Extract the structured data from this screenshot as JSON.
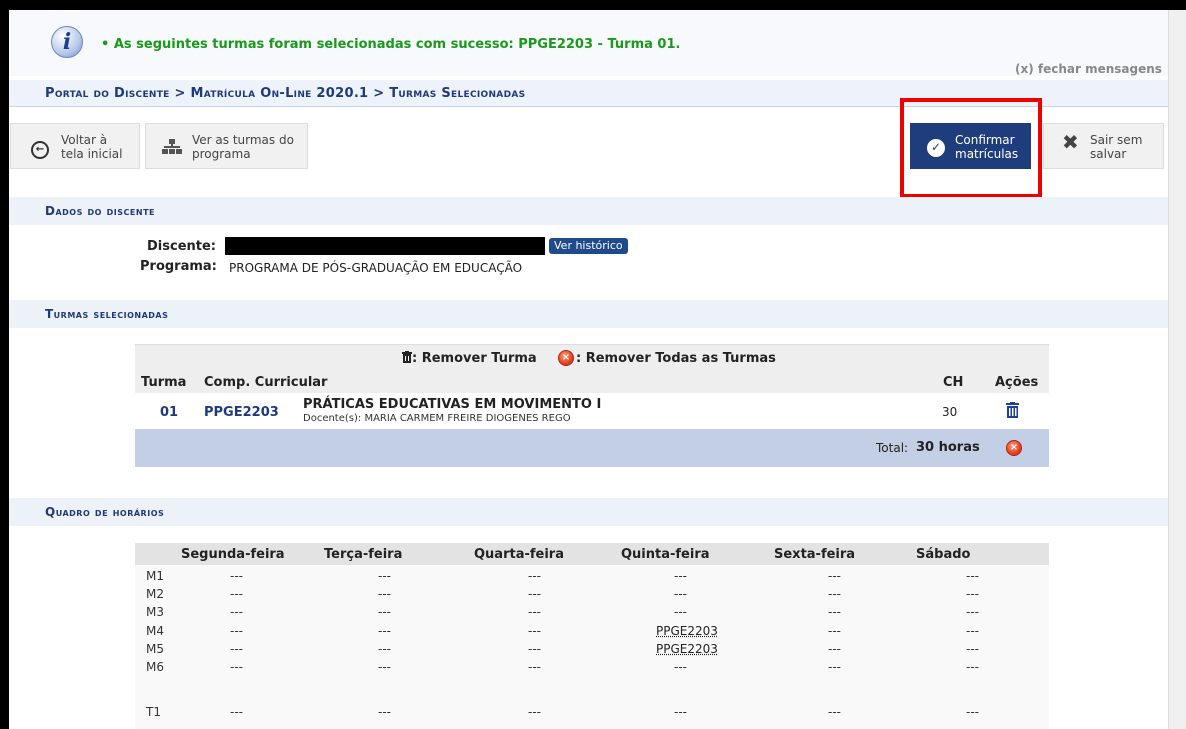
{
  "message": {
    "text": "• As seguintes turmas foram selecionadas com sucesso: PPGE2203 - Turma 01.",
    "close": "(x) fechar mensagens",
    "icon": "info-icon"
  },
  "breadcrumb": "Portal do Discente > Matrícula On-Line 2020.1 > Turmas Selecionadas",
  "toolbar": {
    "voltar": [
      "Voltar à",
      "tela inicial"
    ],
    "ver": [
      "Ver as turmas do",
      "programa"
    ],
    "confirmar": [
      "Confirmar",
      "matrículas"
    ],
    "sair": [
      "Sair sem",
      "salvar"
    ]
  },
  "dados": {
    "title": "Dados do discente",
    "discente_label": "Discente:",
    "ver_historico": "Ver histórico",
    "programa_label": "Programa:",
    "programa_value": "PROGRAMA DE PÓS-GRADUAÇÃO EM EDUCAÇÃO"
  },
  "turmas": {
    "title": "Turmas selecionadas",
    "legend_remove": ": Remover Turma",
    "legend_remove_all": ": Remover Todas as Turmas",
    "headers": {
      "turma": "Turma",
      "comp": "Comp. Curricular",
      "ch": "CH",
      "acoes": "Ações"
    },
    "row": {
      "turma": "01",
      "codigo": "PPGE2203",
      "nome": "PRÁTICAS EDUCATIVAS EM MOVIMENTO I",
      "docente": "Docente(s): MARIA CARMEM FREIRE DIOGENES REGO",
      "ch": "30"
    },
    "total_label": "Total:",
    "total_value": "30 horas"
  },
  "horarios": {
    "title": "Quadro de horários",
    "days": [
      "Segunda-feira",
      "Terça-feira",
      "Quarta-feira",
      "Quinta-feira",
      "Sexta-feira",
      "Sábado"
    ],
    "rows": [
      {
        "slot": "M1",
        "cells": [
          "---",
          "---",
          "---",
          "---",
          "---",
          "---"
        ]
      },
      {
        "slot": "M2",
        "cells": [
          "---",
          "---",
          "---",
          "---",
          "---",
          "---"
        ]
      },
      {
        "slot": "M3",
        "cells": [
          "---",
          "---",
          "---",
          "---",
          "---",
          "---"
        ]
      },
      {
        "slot": "M4",
        "cells": [
          "---",
          "---",
          "---",
          "PPGE2203",
          "---",
          "---"
        ]
      },
      {
        "slot": "M5",
        "cells": [
          "---",
          "---",
          "---",
          "PPGE2203",
          "---",
          "---"
        ]
      },
      {
        "slot": "M6",
        "cells": [
          "---",
          "---",
          "---",
          "---",
          "---",
          "---"
        ]
      },
      {
        "slot": "T1",
        "cells": [
          "---",
          "---",
          "---",
          "---",
          "---",
          "---"
        ]
      }
    ]
  }
}
